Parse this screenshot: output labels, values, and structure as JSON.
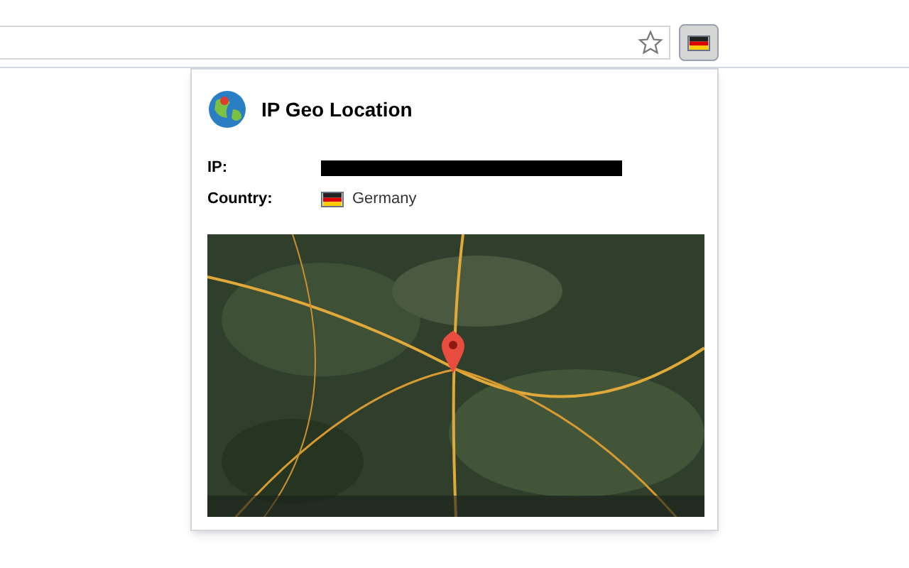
{
  "popup": {
    "title": "IP Geo Location",
    "fields": [
      {
        "label": "IP:",
        "kind": "redacted"
      },
      {
        "label": "Country:",
        "kind": "country",
        "value": "Germany"
      }
    ]
  }
}
